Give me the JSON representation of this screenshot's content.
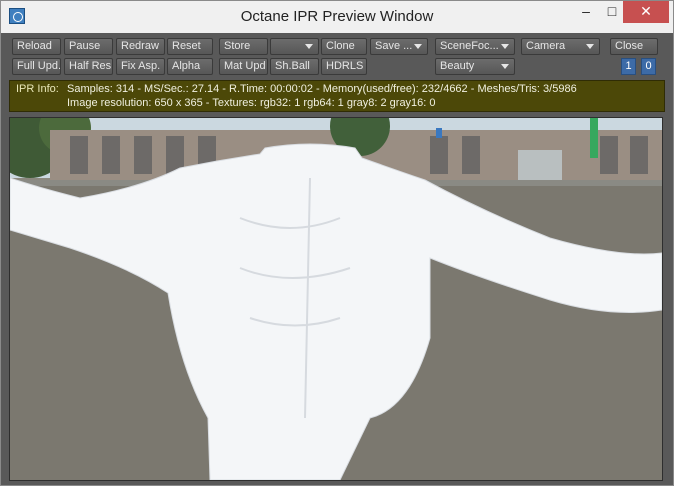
{
  "window": {
    "title": "Octane IPR Preview Window",
    "controls": {
      "minimize": "–",
      "maximize": "□",
      "close": "✕"
    }
  },
  "toolbar": {
    "row1": {
      "reload": "Reload",
      "pause": "Pause",
      "redraw": "Redraw",
      "reset": "Reset",
      "store": "Store",
      "store_select": "",
      "clone": "Clone",
      "save": "Save ...",
      "scene_focus": "SceneFoc...",
      "camera": "Camera",
      "close": "Close"
    },
    "row2": {
      "full_update": "Full Upd.",
      "half_res": "Half Res",
      "fix_aspect": "Fix Asp.",
      "alpha": "Alpha",
      "mat_update": "Mat Upd",
      "sh_ball": "Sh.Ball",
      "hdrls": "HDRLS",
      "render_pass": "Beauty",
      "view_1": "1",
      "view_2": "0"
    }
  },
  "ipr_info": {
    "label": "IPR Info:",
    "line1": "Samples: 314  -  MS/Sec.: 27.14  -  R.Time: 00:00:02 - Memory(used/free): 232/4662  -  Meshes/Tris: 3/5986",
    "line2": "Image resolution: 650 x 365 - Textures:  rgb32: 1   rgb64: 1   gray8: 2   gray16: 0"
  },
  "colors": {
    "window_bg": "#595959",
    "info_bg": "#4c4808",
    "accent_blue": "#3d6ba7",
    "close_red": "#c75050"
  }
}
